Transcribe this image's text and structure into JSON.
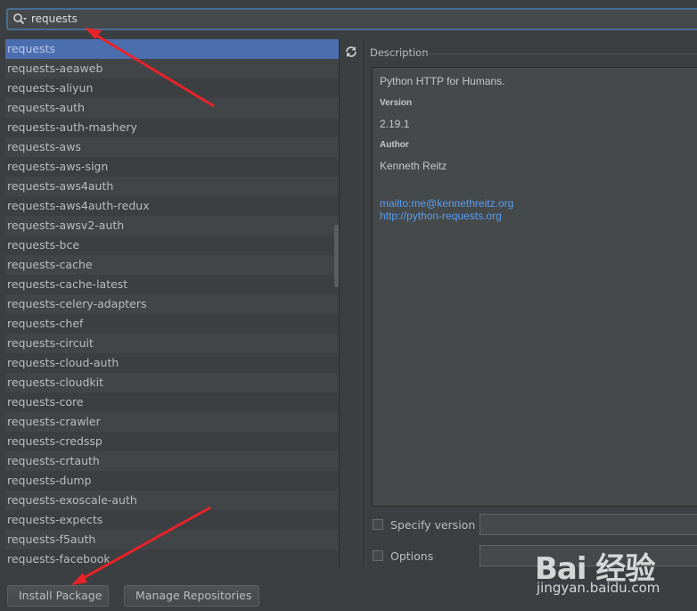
{
  "search": {
    "query": "requests"
  },
  "packages": {
    "selected_index": 0,
    "items": [
      "requests",
      "requests-aeaweb",
      "requests-aliyun",
      "requests-auth",
      "requests-auth-mashery",
      "requests-aws",
      "requests-aws-sign",
      "requests-aws4auth",
      "requests-aws4auth-redux",
      "requests-awsv2-auth",
      "requests-bce",
      "requests-cache",
      "requests-cache-latest",
      "requests-celery-adapters",
      "requests-chef",
      "requests-circuit",
      "requests-cloud-auth",
      "requests-cloudkit",
      "requests-core",
      "requests-crawler",
      "requests-credssp",
      "requests-crtauth",
      "requests-dump",
      "requests-exoscale-auth",
      "requests-expects",
      "requests-f5auth",
      "requests-facebook"
    ]
  },
  "description": {
    "title": "Description",
    "summary": "Python HTTP for Humans.",
    "version_label": "Version",
    "version": "2.19.1",
    "author_label": "Author",
    "author": "Kenneth Reitz",
    "email_link": "mailto:me@kennethreitz.org",
    "home_link": "http://python-requests.org"
  },
  "options": {
    "specify_version_label": "Specify version",
    "options_label": "Options"
  },
  "buttons": {
    "install": "Install Package",
    "manage": "Manage Repositories"
  },
  "watermark": {
    "logo": "Bai 经验",
    "site": "jingyan.baidu.com"
  },
  "colors": {
    "selection": "#4b6eaf",
    "link": "#589df6",
    "annotation_arrow": "#e8232a"
  }
}
